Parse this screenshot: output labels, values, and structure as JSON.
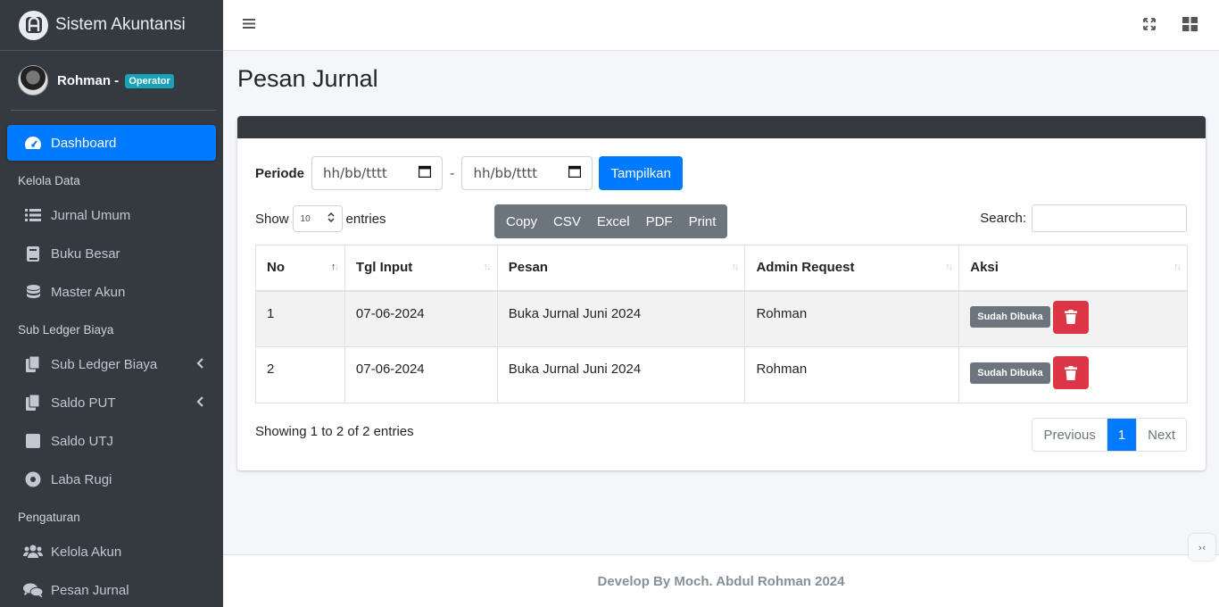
{
  "brand": {
    "title": "Sistem Akuntansi"
  },
  "user": {
    "name": "Rohman -",
    "role": "Operator"
  },
  "sidebar": {
    "dashboard": "Dashboard",
    "header1": "Kelola Data",
    "jurnal_umum": "Jurnal Umum",
    "buku_besar": "Buku Besar",
    "master_akun": "Master Akun",
    "header2": "Sub Ledger Biaya",
    "sub_ledger_biaya": "Sub Ledger Biaya",
    "saldo_put": "Saldo PUT",
    "saldo_utj": "Saldo UTJ",
    "laba_rugi": "Laba Rugi",
    "header3": "Pengaturan",
    "kelola_akun": "Kelola Akun",
    "pesan_jurnal": "Pesan Jurnal"
  },
  "page": {
    "title": "Pesan Jurnal"
  },
  "filter": {
    "label": "Periode",
    "date_from_placeholder": "hh/bb/tttt",
    "separator": "-",
    "date_to_placeholder": "hh/bb/tttt",
    "submit": "Tampilkan"
  },
  "table_controls": {
    "show": "Show",
    "length": "10",
    "entries": "entries",
    "buttons": {
      "copy": "Copy",
      "csv": "CSV",
      "excel": "Excel",
      "pdf": "PDF",
      "print": "Print"
    },
    "search_label": "Search:"
  },
  "table": {
    "headers": [
      "No",
      "Tgl Input",
      "Pesan",
      "Admin Request",
      "Aksi"
    ],
    "rows": [
      {
        "no": "1",
        "tgl": "07-06-2024",
        "pesan": "Buka Jurnal Juni 2024",
        "admin": "Rohman",
        "status": "Sudah Dibuka"
      },
      {
        "no": "2",
        "tgl": "07-06-2024",
        "pesan": "Buka Jurnal Juni 2024",
        "admin": "Rohman",
        "status": "Sudah Dibuka"
      }
    ]
  },
  "info": "Showing 1 to 2 of 2 entries",
  "pagination": {
    "previous": "Previous",
    "current": "1",
    "next": "Next"
  },
  "footer": "Develop By Moch. Abdul Rohman 2024",
  "colors": {
    "primary": "#007bff",
    "sidebar": "#343a40",
    "danger": "#dc3545",
    "secondary": "#6c757d",
    "info": "#17a2b8"
  }
}
